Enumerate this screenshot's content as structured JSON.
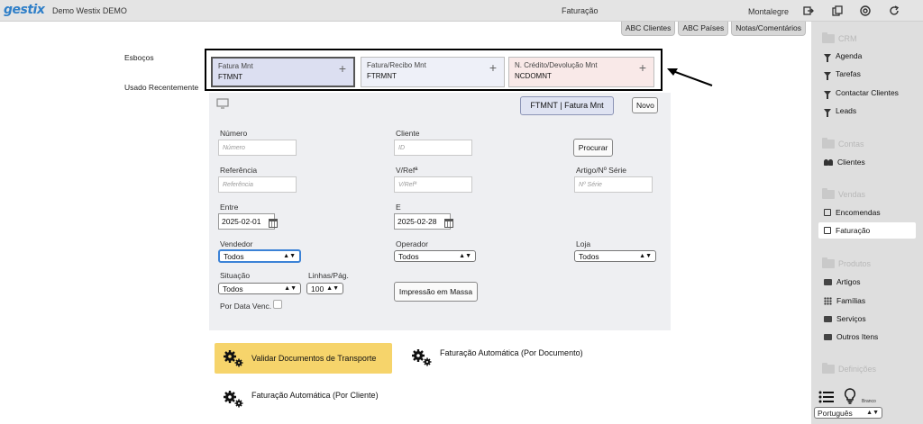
{
  "topbar": {
    "logo": "gestix",
    "company": "Demo Westix DEMO",
    "title": "Faturação",
    "user": "Montalegre"
  },
  "tabs": [
    "ABC Clientes",
    "ABC Países",
    "Notas/Comentários"
  ],
  "labels": {
    "drafts": "Esboços",
    "recent": "Usado Recentemente"
  },
  "drafts": [
    {
      "title": "Fatura Mnt",
      "code": "FTMNT",
      "plus": "+",
      "color": "#dcdff1"
    },
    {
      "title": "Fatura/Recibo Mnt",
      "code": "FTRMNT",
      "plus": "+",
      "color": "#eef0f8"
    },
    {
      "title": "N. Crédito/Devolução Mnt",
      "code": "NCDOMNT",
      "plus": "+",
      "color": "#f9e9e8"
    }
  ],
  "panel": {
    "doc_type": "FTMNT | Fatura Mnt",
    "new_button": "Novo",
    "numero_label": "Número",
    "numero_placeholder": "Número",
    "cliente_label": "Cliente",
    "cliente_placeholder": "ID",
    "procurar_button": "Procurar",
    "referencia_label": "Referência",
    "referencia_placeholder": "Referência",
    "vref_label": "V/Refª",
    "vref_placeholder": "V/Refª",
    "artigo_label": "Artigo/Nº Série",
    "artigo_placeholder": "Nº Série",
    "entre_label": "Entre",
    "entre_value": "2025-02-01",
    "e_label": "E",
    "e_value": "2025-02-28",
    "vendedor_label": "Vendedor",
    "vendedor_value": "Todos",
    "operador_label": "Operador",
    "operador_value": "Todos",
    "loja_label": "Loja",
    "loja_value": "Todos",
    "situacao_label": "Situação",
    "situacao_value": "Todos",
    "linhas_label": "Linhas/Pág.",
    "linhas_value": "100",
    "impressao_button": "Impressão em Massa",
    "por_data_label": "Por Data Venc."
  },
  "actions": {
    "validar": "Validar Documentos de Transporte",
    "auto_doc": "Faturação Automática (Por Documento)",
    "auto_cliente": "Faturação Automática (Por Cliente)"
  },
  "sidebar": {
    "crm": "CRM",
    "agenda": "Agenda",
    "tarefas": "Tarefas",
    "contactar": "Contactar Clientes",
    "leads": "Leads",
    "contas": "Contas",
    "clientes": "Clientes",
    "vendas": "Vendas",
    "encomendas": "Encomendas",
    "faturacao": "Faturação",
    "produtos": "Produtos",
    "artigos": "Artigos",
    "familias": "Famílias",
    "servicos": "Serviços",
    "outros": "Outros Itens",
    "definicoes": "Definições",
    "branco": "Branco",
    "language": "Português"
  },
  "colors": {
    "highlight": "#f6d46b",
    "sidebar_bg": "#dedede",
    "panel_bg": "#eeeff2",
    "focus": "#3b82d6"
  }
}
